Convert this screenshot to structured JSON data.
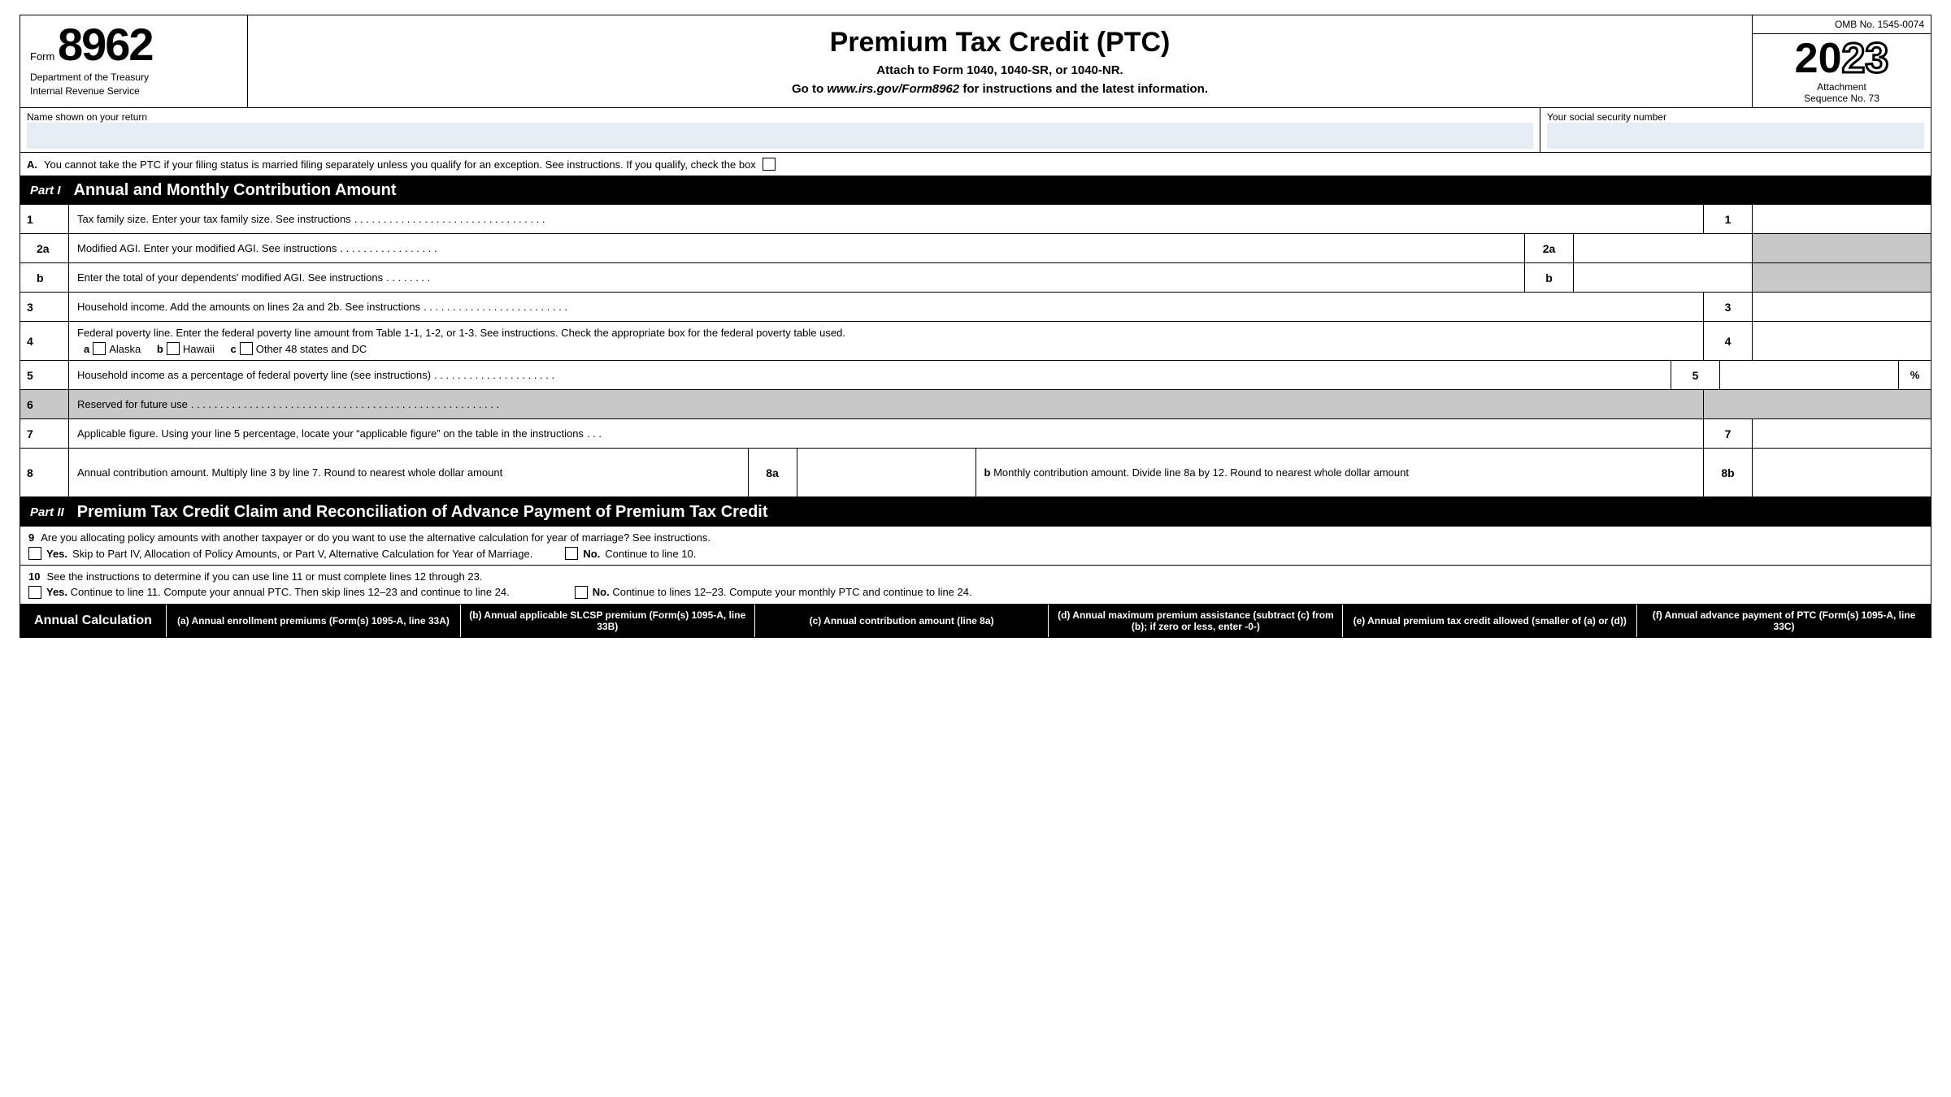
{
  "header": {
    "form_label": "Form",
    "form_number": "8962",
    "dept_line1": "Department of the Treasury",
    "dept_line2": "Internal Revenue Service",
    "title": "Premium Tax Credit (PTC)",
    "subtitle1": "Attach to Form 1040, 1040-SR, or 1040-NR.",
    "subtitle2": "Go to www.irs.gov/Form8962 for instructions and the latest information.",
    "omb": "OMB No. 1545-0074",
    "year": "2023",
    "year_first": "20",
    "year_bold": "23",
    "attachment": "Attachment",
    "sequence": "Sequence No. 73"
  },
  "name_row": {
    "name_label": "Name shown on your return",
    "ssn_label": "Your social security number"
  },
  "part_a": {
    "label": "A.",
    "text": "You cannot take the PTC if your filing status is married filing separately unless you qualify for an exception. See instructions. If you qualify, check the box"
  },
  "part1": {
    "badge": "Part I",
    "title": "Annual and Monthly Contribution Amount"
  },
  "lines": {
    "l1_num": "1",
    "l1_desc": "Tax family size. Enter your tax family size. See instructions",
    "l1_dots": ". . . . . . . . . . . . . . . . . . . . . . . . . . . . . . . . .",
    "l2a_num": "2a",
    "l2a_desc": "Modified AGI. Enter your modified AGI. See instructions",
    "l2a_dots": ". . . . . . . . . . . . . . . . .",
    "l2b_num": "b",
    "l2b_desc": "Enter the total of your dependents' modified AGI. See instructions",
    "l2b_dots": ". . . . . . . .",
    "l3_num": "3",
    "l3_desc": "Household income. Add the amounts on lines 2a and 2b. See instructions",
    "l3_dots": ". . . . . . . . . . . . . . . . . . . . . . . . .",
    "l4_num": "4",
    "l4_desc1": "Federal poverty line. Enter the federal poverty line amount from Table 1-1, 1-2, or 1-3. See instructions. Check the appropriate box for the federal poverty table used.",
    "l4_a": "a",
    "l4_alaska": "Alaska",
    "l4_b": "b",
    "l4_hawaii": "Hawaii",
    "l4_c": "c",
    "l4_other": "Other 48 states and DC",
    "l5_num": "5",
    "l5_desc": "Household income as a percentage of federal poverty line (see instructions)",
    "l5_dots": ". . . . . . . . . . . . . . . . . . . . .",
    "l5_pct": "%",
    "l6_num": "6",
    "l6_desc": "Reserved for future use",
    "l6_dots": ". . . . . . . . . . . . . . . . . . . . . . . . . . . . . . . . . . . . . . . . . . . . . . . . . . . . .",
    "l7_num": "7",
    "l7_desc": "Applicable figure. Using your line 5 percentage, locate your “applicable figure” on the table in the instructions",
    "l7_dots": ". . .",
    "l8a_num": "8a",
    "l8a_desc": "Annual contribution amount. Multiply line 3 by line 7. Round to nearest whole dollar amount",
    "l8b_marker": "b",
    "l8b_desc": "Monthly contribution amount. Divide line 8a by 12. Round to nearest whole dollar amount",
    "l8b_num": "8b"
  },
  "part2": {
    "badge": "Part II",
    "title": "Premium Tax Credit Claim and Reconciliation of Advance Payment of Premium Tax Credit"
  },
  "line9": {
    "num": "9",
    "question": "Are you allocating policy amounts with another taxpayer or do you want to use the alternative calculation for year of marriage? See instructions.",
    "yes_label": "Yes.",
    "yes_text": "Skip to Part IV, Allocation of Policy Amounts, or Part V, Alternative Calculation for Year of Marriage.",
    "no_label": "No.",
    "no_text": "Continue to line 10."
  },
  "line10": {
    "num": "10",
    "desc": "See the instructions to determine if you can use line 11 or must complete lines 12 through 23.",
    "yes_label": "Yes.",
    "yes_text": "Continue to line 11. Compute your annual PTC. Then skip lines 12–23 and continue to line 24.",
    "no_label": "No.",
    "no_text": "Continue to lines 12–23. Compute your monthly PTC and continue to line 24."
  },
  "table_header": {
    "annual_calc": "Annual Calculation",
    "col_a": "(a) Annual enrollment premiums (Form(s) 1095-A, line 33A)",
    "col_b": "(b) Annual applicable SLCSP premium (Form(s) 1095-A, line 33B)",
    "col_c": "(c) Annual contribution amount (line 8a)",
    "col_d": "(d) Annual maximum premium assistance (subtract (c) from (b); if zero or less, enter -0-)",
    "col_e": "(e) Annual premium tax credit allowed (smaller of (a) or (d))",
    "col_f": "(f) Annual advance payment of PTC (Form(s) 1095-A, line 33C)"
  }
}
